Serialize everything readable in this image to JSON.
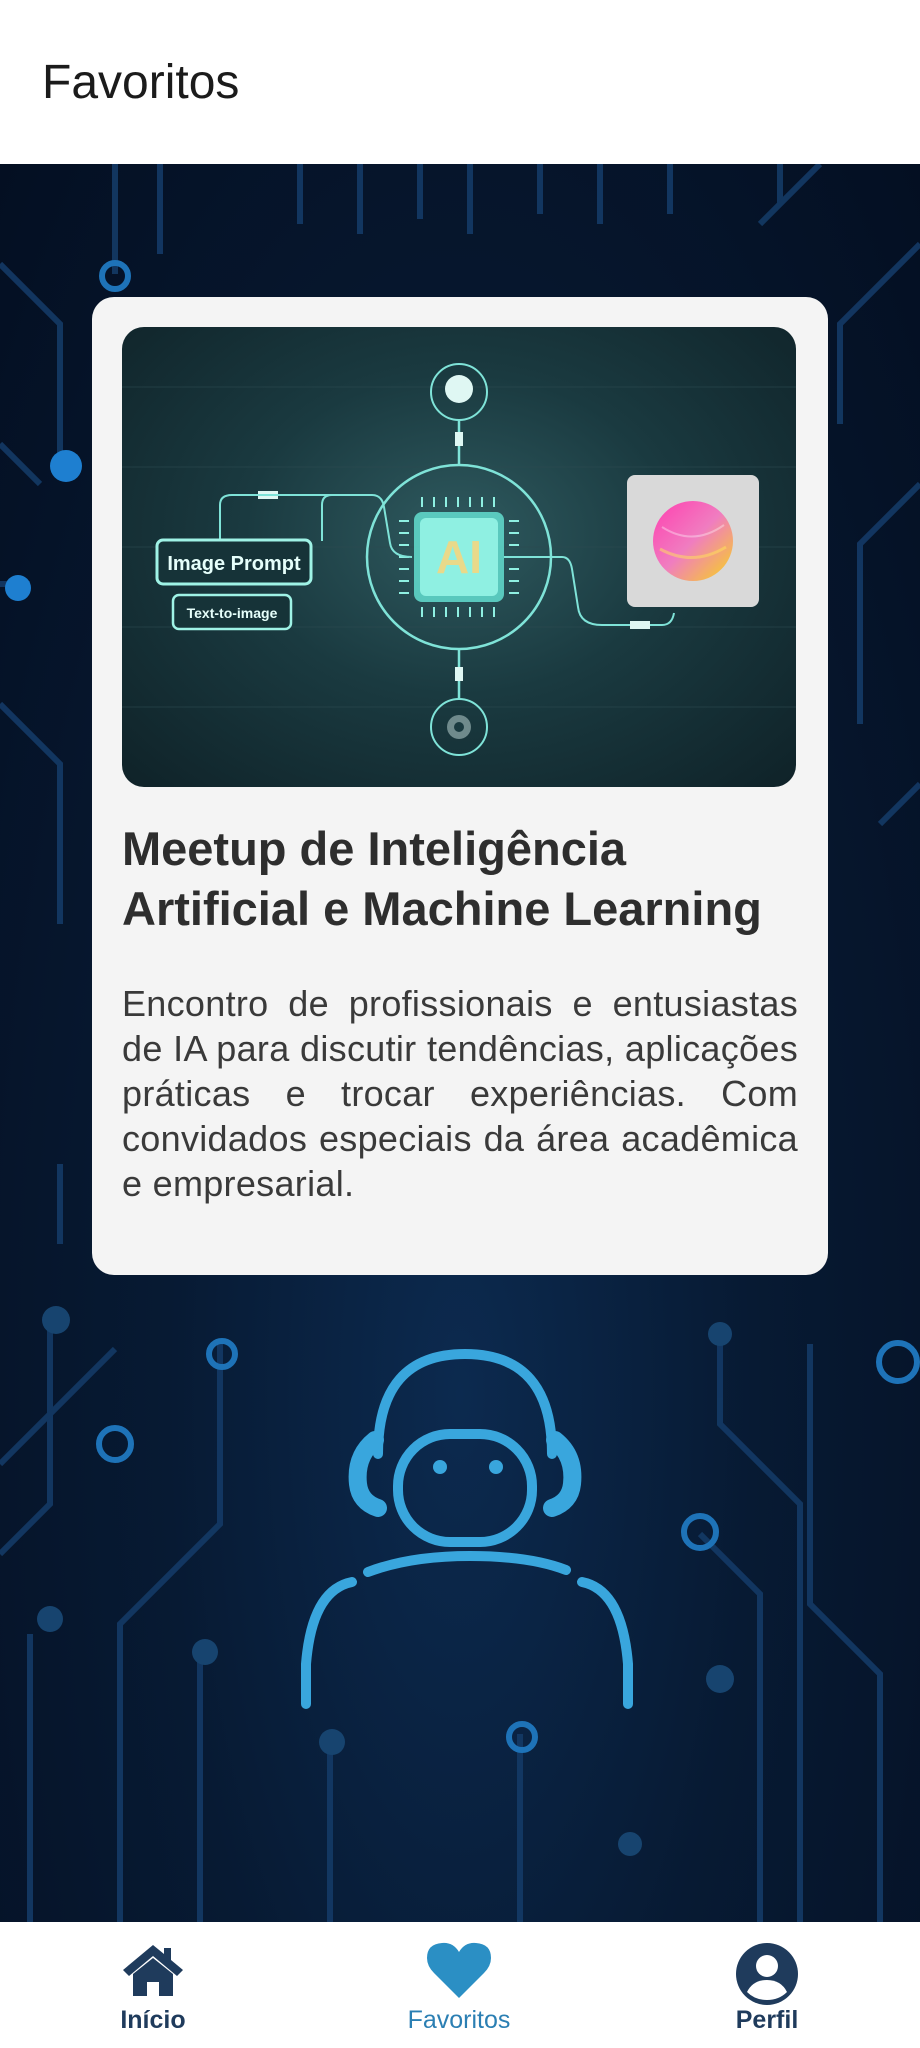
{
  "header": {
    "title": "Favoritos"
  },
  "event": {
    "image_labels": {
      "prompt": "Image Prompt",
      "text_to_image": "Text-to-image",
      "chip": "AI"
    },
    "title": "Meetup de Inteligência Artificial e Machine Learning",
    "description": "Encontro de profissionais e entusiastas de IA para discutir tendências, aplicações práticas e trocar experiências. Com convidados especiais da área acadêmica e empresarial."
  },
  "nav": {
    "items": [
      {
        "label": "Início",
        "icon": "home-icon",
        "active": false
      },
      {
        "label": "Favoritos",
        "icon": "heart-icon",
        "active": true
      },
      {
        "label": "Perfil",
        "icon": "profile-icon",
        "active": false
      }
    ]
  },
  "colors": {
    "nav_default": "#1f3b5c",
    "nav_active": "#2b7fb3",
    "background": "#071a33",
    "card": "#f4f4f4"
  }
}
